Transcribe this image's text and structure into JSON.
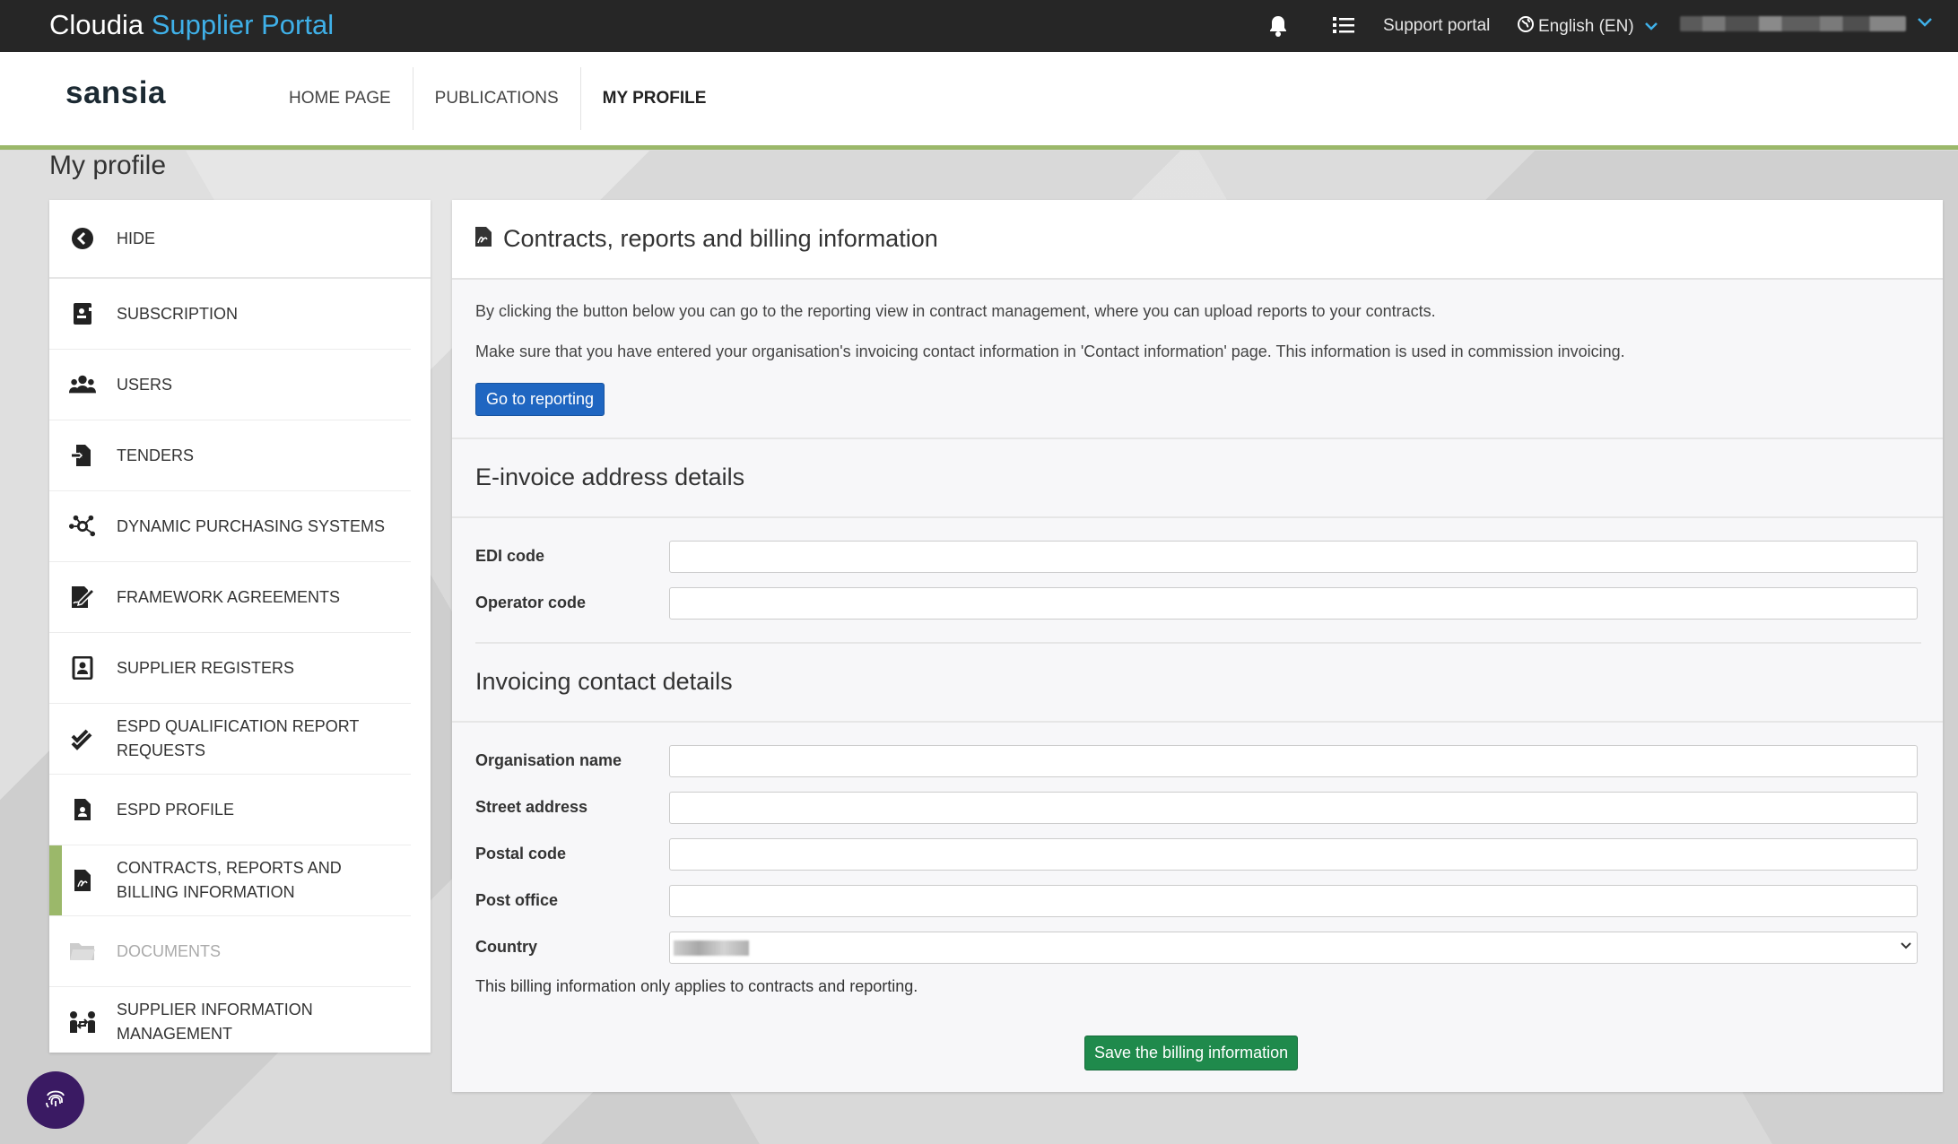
{
  "topbar": {
    "brand_main": "Cloudia",
    "brand_accent": "Supplier Portal",
    "support_label": "Support portal",
    "language_label": "English (EN)"
  },
  "nav": {
    "logo": "sansia",
    "items": [
      "HOME PAGE",
      "PUBLICATIONS",
      "MY PROFILE"
    ],
    "active": "MY PROFILE"
  },
  "page_title": "My profile",
  "sidebar": {
    "hide_label": "HIDE",
    "items": [
      {
        "label": "SUBSCRIPTION",
        "icon": "subscription-icon"
      },
      {
        "label": "USERS",
        "icon": "users-icon"
      },
      {
        "label": "TENDERS",
        "icon": "tenders-icon"
      },
      {
        "label": "DYNAMIC PURCHASING SYSTEMS",
        "icon": "network-icon"
      },
      {
        "label": "FRAMEWORK AGREEMENTS",
        "icon": "signature-icon"
      },
      {
        "label": "SUPPLIER REGISTERS",
        "icon": "register-icon"
      },
      {
        "label": "ESPD QUALIFICATION REPORT REQUESTS",
        "icon": "check-double-icon"
      },
      {
        "label": "ESPD PROFILE",
        "icon": "profile-file-icon"
      },
      {
        "label": "CONTRACTS, REPORTS AND BILLING INFORMATION",
        "icon": "contract-file-icon",
        "active": true
      },
      {
        "label": "DOCUMENTS",
        "icon": "folder-icon",
        "disabled": true
      },
      {
        "label": "SUPPLIER INFORMATION MANAGEMENT",
        "icon": "exchange-users-icon"
      }
    ]
  },
  "main": {
    "title": "Contracts, reports and billing information",
    "para1": "By clicking the button below you can go to the reporting view in contract management, where you can upload reports to your contracts.",
    "para2": "Make sure that you have entered your organisation's invoicing contact information in 'Contact information' page. This information is used in commission invoicing.",
    "reporting_button": "Go to reporting",
    "einvoice_title": "E-invoice address details",
    "edi_label": "EDI code",
    "edi_value": "",
    "operator_label": "Operator code",
    "operator_value": "",
    "invoicing_title": "Invoicing contact details",
    "org_label": "Organisation name",
    "street_label": "Street address",
    "postal_label": "Postal code",
    "office_label": "Post office",
    "country_label": "Country",
    "note": "This billing information only applies to contracts and reporting.",
    "save_button": "Save the billing information"
  },
  "colors": {
    "accent_blue": "#3fb0e8",
    "active_green": "#9bb86a",
    "primary_button": "#1f66c1",
    "save_button": "#1f8a4c"
  }
}
